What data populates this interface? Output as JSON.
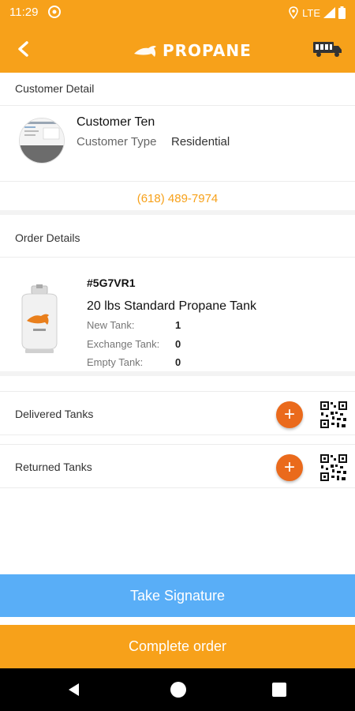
{
  "status_bar": {
    "time": "11:29",
    "network": "LTE"
  },
  "header": {
    "logo_text": "PROPANE"
  },
  "customer_section": {
    "title": "Customer Detail",
    "name": "Customer Ten",
    "type_label": "Customer Type",
    "type_value": "Residential",
    "phone": "(618) 489-7974"
  },
  "order_section": {
    "title": "Order Details",
    "order_id": "#5G7VR1",
    "item_name": "20 lbs Standard Propane Tank",
    "new_tank_label": "New Tank:",
    "new_tank_value": "1",
    "exchange_tank_label": "Exchange Tank:",
    "exchange_tank_value": "0",
    "empty_tank_label": "Empty Tank:",
    "empty_tank_value": "0"
  },
  "tanks": {
    "delivered_label": "Delivered Tanks",
    "returned_label": "Returned Tanks"
  },
  "actions": {
    "signature_label": "Take Signature",
    "complete_label": "Complete order"
  },
  "colors": {
    "primary": "#f7a11a",
    "accent_blue": "#59aef7",
    "plus_orange": "#ea6a1c"
  }
}
